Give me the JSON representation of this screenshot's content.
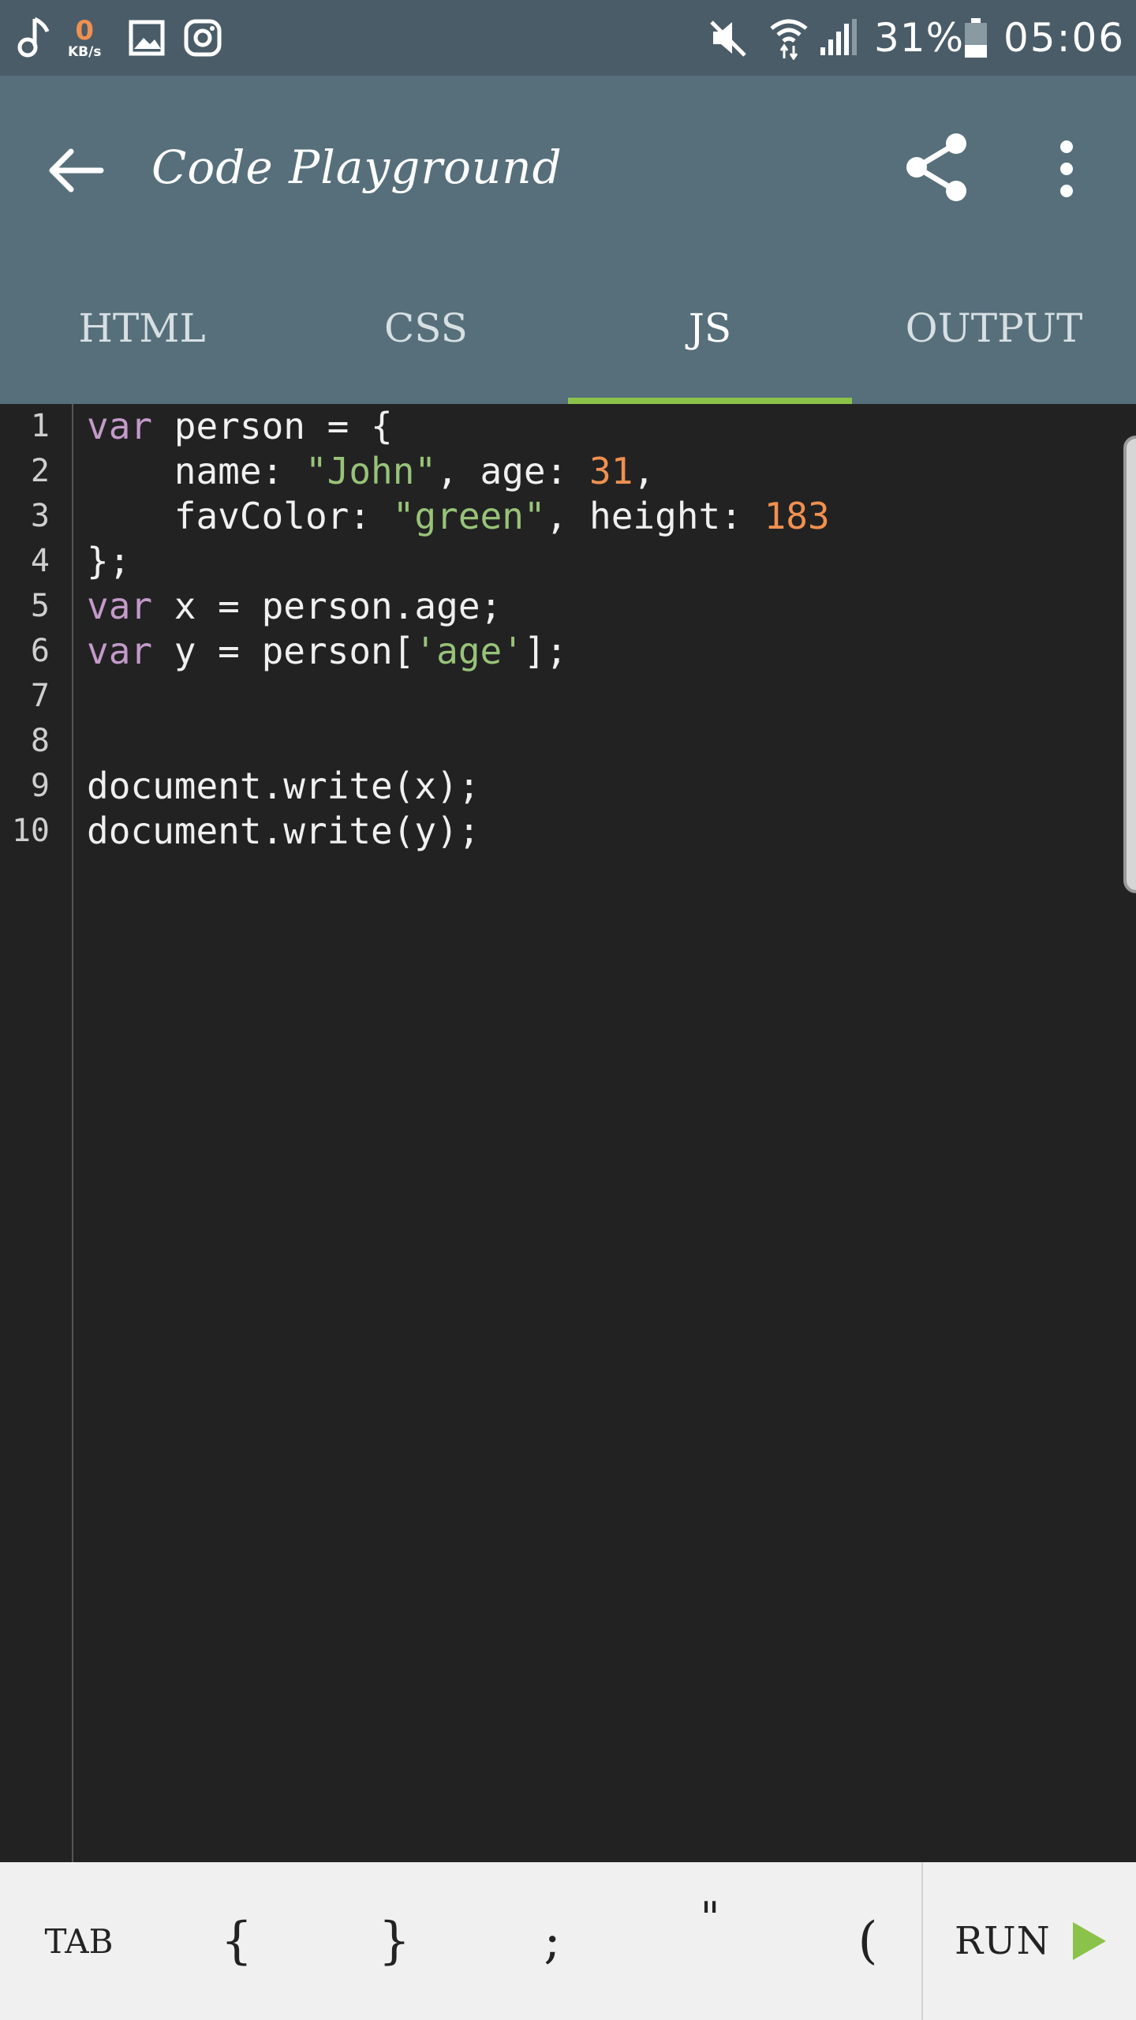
{
  "status_bar": {
    "speed_value": "0",
    "speed_unit": "KB/s",
    "battery": "31%",
    "time": "05:06",
    "icons": [
      "music-note-icon",
      "gallery-icon",
      "instagram-icon",
      "mute-icon",
      "wifi-icon",
      "signal-icon",
      "battery-icon"
    ]
  },
  "app_bar": {
    "title": "Code Playground",
    "icons": [
      "back-arrow-icon",
      "share-icon",
      "more-vert-icon"
    ]
  },
  "tabs": [
    {
      "label": "HTML"
    },
    {
      "label": "CSS"
    },
    {
      "label": "JS"
    },
    {
      "label": "OUTPUT"
    }
  ],
  "active_tab": "JS",
  "accent_color": "#8bc34a",
  "editor": {
    "line_numbers": [
      "1",
      "2",
      "3",
      "4",
      "5",
      "6",
      "7",
      "8",
      "9",
      "10"
    ],
    "lines": [
      [
        {
          "t": "var",
          "c": "kw"
        },
        {
          "t": " person = {"
        }
      ],
      [
        {
          "t": "    name: "
        },
        {
          "t": "\"John\"",
          "c": "str"
        },
        {
          "t": ", age: "
        },
        {
          "t": "31",
          "c": "num"
        },
        {
          "t": ","
        }
      ],
      [
        {
          "t": "    favColor: "
        },
        {
          "t": "\"green\"",
          "c": "str"
        },
        {
          "t": ", height: "
        },
        {
          "t": "183",
          "c": "num"
        }
      ],
      [
        {
          "t": "};"
        }
      ],
      [
        {
          "t": "var",
          "c": "kw"
        },
        {
          "t": " x = person.age;"
        }
      ],
      [
        {
          "t": "var",
          "c": "kw"
        },
        {
          "t": " y = person["
        },
        {
          "t": "'age'",
          "c": "str"
        },
        {
          "t": "];"
        }
      ],
      [],
      [],
      [
        {
          "t": "document.write(x);"
        }
      ],
      [
        {
          "t": "document.write(y);"
        }
      ]
    ]
  },
  "toolbar": {
    "tab_key": "TAB",
    "lbrace_key": "{",
    "rbrace_key": "}",
    "semicolon_key": ";",
    "quote_key": "\"",
    "lparen_key": "(",
    "run_label": "RUN",
    "run_icon": "play-icon"
  }
}
